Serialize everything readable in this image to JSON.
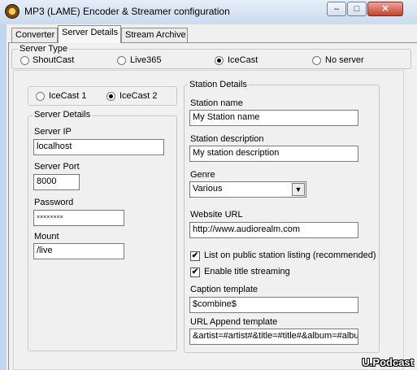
{
  "window": {
    "title": "MP3 (LAME) Encoder & Streamer configuration",
    "minimize_glyph": "–",
    "maximize_glyph": "□",
    "close_glyph": "✕"
  },
  "tabs": [
    {
      "label": "Converter"
    },
    {
      "label": "Server Details",
      "active": true
    },
    {
      "label": "Stream Archive"
    }
  ],
  "server_type": {
    "legend": "Server Type",
    "options": [
      "ShoutCast",
      "Live365",
      "IceCast",
      "No server"
    ],
    "selected": "IceCast"
  },
  "icecast_version": {
    "options": [
      "IceCast 1",
      "IceCast 2"
    ],
    "selected": "IceCast 2"
  },
  "server_details": {
    "legend": "Server Details",
    "ip_label": "Server IP",
    "ip_value": "localhost",
    "port_label": "Server Port",
    "port_value": "8000",
    "password_label": "Password",
    "password_value": "××××××××",
    "mount_label": "Mount",
    "mount_value": "/live"
  },
  "station_details": {
    "legend": "Station Details",
    "name_label": "Station name",
    "name_value": "My Station name",
    "description_label": "Station description",
    "description_value": "My station description",
    "genre_label": "Genre",
    "genre_value": "Various",
    "website_label": "Website URL",
    "website_value": "http://www.audiorealm.com",
    "list_public_label": "List on public station listing (recommended)",
    "list_public_checked": true,
    "title_streaming_label": "Enable title streaming",
    "title_streaming_checked": true,
    "caption_label": "Caption template",
    "caption_value": "$combine$",
    "url_append_label": "URL Append template",
    "url_append_value": "&artist=#artist#&title=#title#&album=#album#"
  },
  "watermark": "U.Podcast",
  "icons": {
    "app": "winamp-disc-icon",
    "check": "✔",
    "dropdown": "▼"
  }
}
